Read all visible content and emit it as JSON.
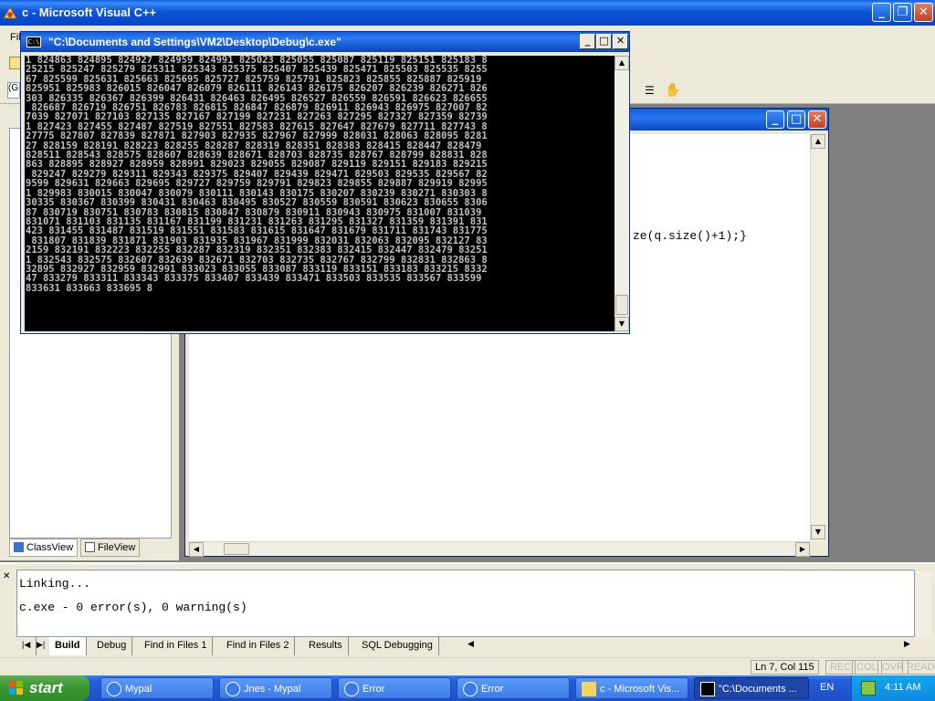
{
  "main_window": {
    "title": "c - Microsoft Visual C++",
    "menu_first": "Fil"
  },
  "editor": {
    "code_line": "ze(q.size()+1);}"
  },
  "console": {
    "title": "\"C:\\Documents and Settings\\VM2\\Desktop\\Debug\\c.exe\"",
    "lines": [
      "1 824863 824895 824927 824959 824991 825023 825055 825087 825119 825151 825183 8",
      "25215 825247 825279 825311 825343 825375 825407 825439 825471 825503 825535 8255",
      "67 825599 825631 825663 825695 825727 825759 825791 825823 825855 825887 825919",
      "825951 825983 826015 826047 826079 826111 826143 826175 826207 826239 826271 826",
      "303 826335 826367 826399 826431 826463 826495 826527 826559 826591 826623 826655",
      " 826687 826719 826751 826783 826815 826847 826879 826911 826943 826975 827007 82",
      "7039 827071 827103 827135 827167 827199 827231 827263 827295 827327 827359 82739",
      "1 827423 827455 827487 827519 827551 827583 827615 827647 827679 827711 827743 8",
      "27775 827807 827839 827871 827903 827935 827967 827999 828031 828063 828095 8281",
      "27 828159 828191 828223 828255 828287 828319 828351 828383 828415 828447 828479",
      "828511 828543 828575 828607 828639 828671 828703 828735 828767 828799 828831 828",
      "863 828895 828927 828959 828991 829023 829055 829087 829119 829151 829183 829215",
      " 829247 829279 829311 829343 829375 829407 829439 829471 829503 829535 829567 82",
      "9599 829631 829663 829695 829727 829759 829791 829823 829855 829887 829919 82995",
      "1 829983 830015 830047 830079 830111 830143 830175 830207 830239 830271 830303 8",
      "30335 830367 830399 830431 830463 830495 830527 830559 830591 830623 830655 8306",
      "87 830719 830751 830783 830815 830847 830879 830911 830943 830975 831007 831039",
      "831071 831103 831135 831167 831199 831231 831263 831295 831327 831359 831391 831",
      "423 831455 831487 831519 831551 831583 831615 831647 831679 831711 831743 831775",
      " 831807 831839 831871 831903 831935 831967 831999 832031 832063 832095 832127 83",
      "2159 832191 832223 832255 832287 832319 832351 832383 832415 832447 832479 83251",
      "1 832543 832575 832607 832639 832671 832703 832735 832767 832799 832831 832863 8",
      "32895 832927 832959 832991 833023 833055 833087 833119 833151 833183 833215 8332",
      "47 833279 833311 833343 833375 833407 833439 833471 833503 833535 833567 833599",
      "833631 833663 833695 8"
    ]
  },
  "left_pane": {
    "tab_classview": "ClassView",
    "tab_fileview": "FileView"
  },
  "output": {
    "line1": "Linking...",
    "line2": "c.exe - 0 error(s), 0 warning(s)",
    "tabs": [
      "Build",
      "Debug",
      "Find in Files 1",
      "Find in Files 2",
      "Results",
      "SQL Debugging"
    ]
  },
  "statusbar": {
    "position": "Ln 7, Col 115",
    "rec": "REC",
    "col": "COL",
    "ovr": "OVR",
    "read": "READ"
  },
  "taskbar": {
    "start": "start",
    "tasks": [
      "Mypal",
      "Jnes - Mypal",
      "Error",
      "Error",
      "c - Microsoft Vis...",
      "\"C:\\Documents ..."
    ],
    "lang": "EN",
    "clock": "4:11 AM"
  }
}
